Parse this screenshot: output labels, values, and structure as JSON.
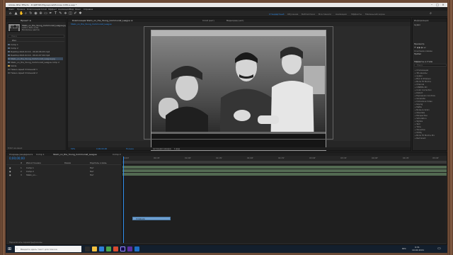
{
  "window": {
    "title": "Adobe After Effects - D:\\ДЕНИС\\Мурадзов\\Москва 1930-е.aep *"
  },
  "menu": [
    "Файл",
    "Правка",
    "Композиция",
    "Слой",
    "Эффект",
    "Анимация",
    "Вид",
    "Окно",
    "Справка"
  ],
  "workspaces": [
    "Стандартный",
    "Обучение",
    "Библиотеки",
    "Все панели",
    "Анимация",
    "Эффекты",
    "Маленький экран"
  ],
  "project": {
    "tab": "Проект ≡",
    "preview_name": "Stalin_on_the_Young_Communist_League.jpg",
    "preview_info": "1280 x 840 (1,00)\nМиллионы цветов",
    "search_placeholder": "Поиск",
    "column": "Имя",
    "items": [
      "Comp 1",
      "Comp 2",
      "Desktop 2021.02.19 - 09.20.06.03.mp4",
      "Desktop 2021.02.19 - 09.21.07.04.mp4",
      "Stalin_on_the_Young_Communist_League.jpg",
      "Stalin_on_the_Young_Communist_League.comp 2",
      "Solids",
      "Темно-серый Сплошной 1",
      "Темно-серый Сплошной 2"
    ],
    "footer": "8 бит на канал"
  },
  "viewer": {
    "tabs": [
      "Композиция Stalin_on_the_Young_Communist_League ≡",
      "Слой (нет)",
      "Видеоряд (нет)"
    ],
    "breadcrumb": "Stalin_on_the_Young_Communist_League",
    "camera_label": "Активная камера",
    "zoom": "50%",
    "timecode": "0;00;00;00",
    "resolution": "Полное",
    "view": "Активная камера",
    "views_count": "1 вид"
  },
  "right_panel": {
    "info_tab": "Информация",
    "audio_tab": "Аудио",
    "preview_tab": "Просмотр",
    "shortcut_label": "Сочетание клавиш",
    "shortcut_value": "Пробел",
    "effects_tab": "Эффекты и стили",
    "search_placeholder": "Поиск",
    "effects": [
      "Стилизация",
      "3D-каналы",
      "Аудио",
      "Blur & Sharpen",
      "Boris FX Mocha",
      "Channel",
      "CINEMA 4D",
      "Color Correction",
      "Distort",
      "Expression Controls",
      "Generate",
      "Immersive Video",
      "Keying",
      "Matte",
      "Noise & Grain",
      "Obsolete",
      "Perspective",
      "Simulation",
      "Stylize",
      "Text",
      "Time",
      "Transition",
      "Utility",
      "Boris FX Mocha Pro",
      "Red Giant"
    ]
  },
  "timeline": {
    "tabs": [
      "Очередь рендеринга",
      "Comp 1",
      "Stalin_on_the_Young_Communist_League",
      "Comp 2"
    ],
    "timecode": "0;00;00;00",
    "columns": [
      "#",
      "Имя источника",
      "Режим",
      "Родитель и связь"
    ],
    "layers": [
      {
        "num": "1",
        "name": "Comp 1",
        "mode": "Нет"
      },
      {
        "num": "2",
        "name": "Comp 2",
        "mode": "Нет"
      },
      {
        "num": "3",
        "name": "Stalin_on...",
        "mode": "Нет"
      }
    ],
    "ruler": [
      "0:00f",
      "00:15f",
      "01:00f",
      "01:15f",
      "02:00f",
      "02:15f",
      "03:00f",
      "03:15f",
      "04:00f",
      "04:15f",
      "05:00f"
    ],
    "tooltip": "Слияние",
    "footer": "Переключить параметры/режимы"
  },
  "taskbar": {
    "search_placeholder": "Введите здесь текст для поиска",
    "time": "9:31",
    "date": "19.02.2021",
    "lang": "РУС"
  },
  "colors": {
    "accent": "#2d8ceb",
    "layer_bar": "#536a52",
    "tooltip": "#6f9fcf"
  }
}
